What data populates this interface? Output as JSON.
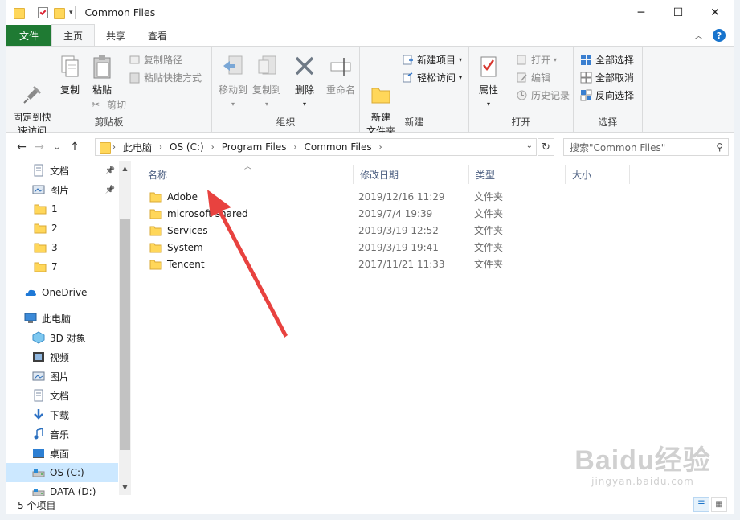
{
  "window": {
    "title": "Common Files",
    "controls": {
      "minimize": "─",
      "maximize": "☐",
      "close": "✕"
    }
  },
  "ribbon_tabs": {
    "file": "文件",
    "home": "主页",
    "share": "共享",
    "view": "查看"
  },
  "ribbon": {
    "clipboard": {
      "label": "剪贴板",
      "pin": "固定到快\n速访问",
      "copy": "复制",
      "paste": "粘贴",
      "copy_path": "复制路径",
      "paste_shortcut": "粘贴快捷方式",
      "cut": "剪切"
    },
    "organize": {
      "label": "组织",
      "move_to": "移动到",
      "copy_to": "复制到",
      "delete": "删除",
      "rename": "重命名"
    },
    "new": {
      "label": "新建",
      "new_folder": "新建\n文件夹",
      "new_item": "新建项目",
      "easy_access": "轻松访问"
    },
    "open": {
      "label": "打开",
      "properties": "属性",
      "open": "打开",
      "edit": "编辑",
      "history": "历史记录"
    },
    "select": {
      "label": "选择",
      "select_all": "全部选择",
      "select_none": "全部取消",
      "invert": "反向选择"
    }
  },
  "address": {
    "crumbs": [
      "此电脑",
      "OS (C:)",
      "Program Files",
      "Common Files"
    ],
    "search_placeholder": "搜索\"Common Files\""
  },
  "nav": {
    "items": [
      {
        "label": "文档",
        "icon": "documents-icon",
        "pinned": true
      },
      {
        "label": "图片",
        "icon": "pictures-icon",
        "pinned": true
      },
      {
        "label": "1",
        "icon": "folder-icon"
      },
      {
        "label": "2",
        "icon": "folder-icon"
      },
      {
        "label": "3",
        "icon": "folder-icon"
      },
      {
        "label": "7",
        "icon": "folder-icon"
      },
      {
        "label": "OneDrive",
        "icon": "onedrive-icon"
      },
      {
        "label": "此电脑",
        "icon": "computer-icon"
      },
      {
        "label": "3D 对象",
        "icon": "3d-objects-icon"
      },
      {
        "label": "视频",
        "icon": "videos-icon"
      },
      {
        "label": "图片",
        "icon": "pictures-icon"
      },
      {
        "label": "文档",
        "icon": "documents-icon"
      },
      {
        "label": "下载",
        "icon": "downloads-icon"
      },
      {
        "label": "音乐",
        "icon": "music-icon"
      },
      {
        "label": "桌面",
        "icon": "desktop-icon"
      },
      {
        "label": "OS (C:)",
        "icon": "drive-icon",
        "selected": true
      },
      {
        "label": "DATA (D:)",
        "icon": "drive-icon"
      }
    ]
  },
  "columns": {
    "name": "名称",
    "date": "修改日期",
    "type": "类型",
    "size": "大小"
  },
  "files": [
    {
      "name": "Adobe",
      "date": "2019/12/16 11:29",
      "type": "文件夹"
    },
    {
      "name": "microsoft shared",
      "date": "2019/7/4 19:39",
      "type": "文件夹"
    },
    {
      "name": "Services",
      "date": "2019/3/19 12:52",
      "type": "文件夹"
    },
    {
      "name": "System",
      "date": "2019/3/19 19:41",
      "type": "文件夹"
    },
    {
      "name": "Tencent",
      "date": "2017/11/21 11:33",
      "type": "文件夹"
    }
  ],
  "status": {
    "item_count": "5 个项目"
  },
  "watermark": {
    "brand": "Baidu经验",
    "url": "jingyan.baidu.com"
  },
  "colors": {
    "file_tab": "#1f7a33",
    "selection": "#cce8ff",
    "annotation_arrow": "#e8423f",
    "folder": "#ffd75a"
  }
}
